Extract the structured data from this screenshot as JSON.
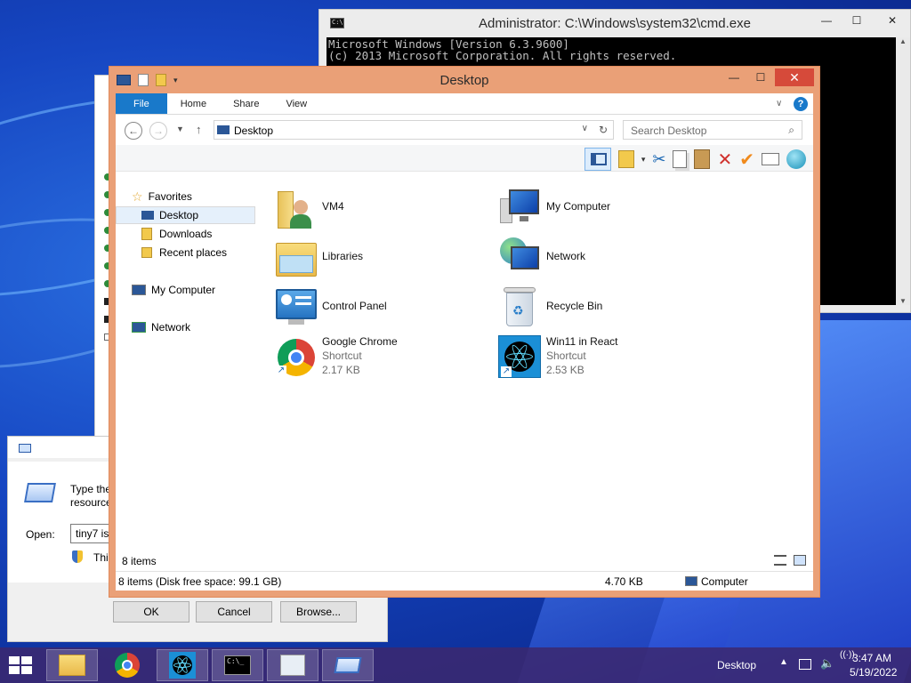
{
  "cmd": {
    "title": "Administrator: C:\\Windows\\system32\\cmd.exe",
    "lines": [
      "Microsoft Windows [Version 6.3.9600]",
      "(c) 2013 Microsoft Corporation. All rights reserved."
    ],
    "controls": {
      "minimize": "—",
      "maximize": "☐",
      "close": "✕"
    },
    "scroll_up": "▲",
    "scroll_down": "▼"
  },
  "run": {
    "prompt_line1": "Type the",
    "prompt_line2": "resource",
    "open_label": "Open:",
    "open_value": "tiny7 is",
    "admin_note": "Thi",
    "ok_label": "OK",
    "cancel_label": "Cancel",
    "browse_label": "Browse..."
  },
  "explorer": {
    "title": "Desktop",
    "controls": {
      "minimize": "—",
      "maximize": "☐",
      "close": "✕"
    },
    "ribbon_tabs": [
      "File",
      "Home",
      "Share",
      "View"
    ],
    "address": "Desktop",
    "search_placeholder": "Search Desktop",
    "nav": {
      "favorites": "Favorites",
      "desktop": "Desktop",
      "downloads": "Downloads",
      "recent": "Recent places",
      "my_computer": "My Computer",
      "network": "Network"
    },
    "items": [
      {
        "name": "VM4",
        "icon": "user-folder-icon"
      },
      {
        "name": "My Computer",
        "icon": "computer-icon"
      },
      {
        "name": "Libraries",
        "icon": "libraries-icon"
      },
      {
        "name": "Network",
        "icon": "network-icon"
      },
      {
        "name": "Control Panel",
        "icon": "control-panel-icon"
      },
      {
        "name": "Recycle Bin",
        "icon": "recycle-bin-icon"
      },
      {
        "name": "Google Chrome",
        "type": "Shortcut",
        "size": "2.17 KB",
        "icon": "chrome-icon"
      },
      {
        "name": "Win11 in React",
        "type": "Shortcut",
        "size": "2.53 KB",
        "icon": "react-icon"
      }
    ],
    "item_count": "8 items",
    "status": {
      "summary": "8 items (Disk free space: 99.1 GB)",
      "size": "4.70 KB",
      "location": "Computer"
    }
  },
  "taskbar": {
    "desktop_label": "Desktop",
    "time": "3:47 AM",
    "date": "5/19/2022"
  }
}
